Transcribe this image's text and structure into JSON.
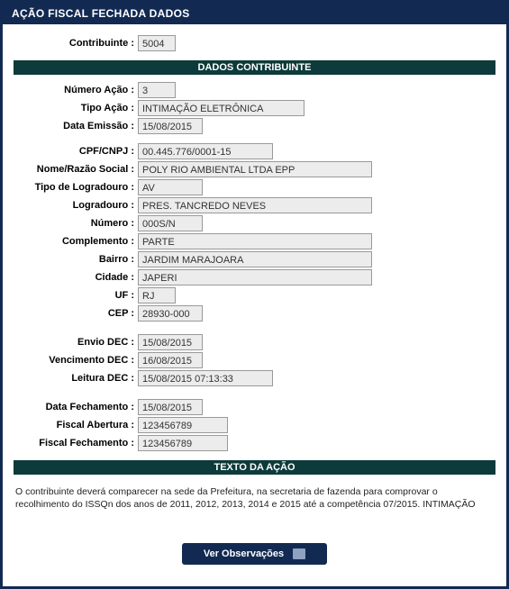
{
  "header": {
    "title": "AÇÃO FISCAL FECHADA DADOS"
  },
  "contribuinte": {
    "label": "Contribuinte :",
    "value": "5004"
  },
  "sections": {
    "dados_contribuinte": "DADOS CONTRIBUINTE",
    "texto_acao": "TEXTO DA AÇÃO"
  },
  "acao": {
    "numero_acao_label": "Número Ação :",
    "numero_acao": "3",
    "tipo_acao_label": "Tipo Ação :",
    "tipo_acao": "INTIMAÇÃO ELETRÔNICA",
    "data_emissao_label": "Data Emissão :",
    "data_emissao": "15/08/2015"
  },
  "endereco": {
    "cpf_cnpj_label": "CPF/CNPJ :",
    "cpf_cnpj": "00.445.776/0001-15",
    "nome_label": "Nome/Razão Social :",
    "nome": "POLY RIO AMBIENTAL LTDA EPP",
    "tipo_logradouro_label": "Tipo de Logradouro :",
    "tipo_logradouro": "AV",
    "logradouro_label": "Logradouro :",
    "logradouro": "PRES. TANCREDO NEVES",
    "numero_label": "Número :",
    "numero": "000S/N",
    "complemento_label": "Complemento :",
    "complemento": "PARTE",
    "bairro_label": "Bairro :",
    "bairro": "JARDIM MARAJOARA",
    "cidade_label": "Cidade :",
    "cidade": "JAPERI",
    "uf_label": "UF :",
    "uf": "RJ",
    "cep_label": "CEP :",
    "cep": "28930-000"
  },
  "dec": {
    "envio_label": "Envio DEC :",
    "envio": "15/08/2015",
    "venc_label": "Vencimento DEC :",
    "venc": "16/08/2015",
    "leitura_label": "Leitura DEC :",
    "leitura": "15/08/2015 07:13:33"
  },
  "fechamento": {
    "data_label": "Data Fechamento :",
    "data": "15/08/2015",
    "abertura_label": "Fiscal Abertura :",
    "abertura": "123456789",
    "fech_label": "Fiscal Fechamento :",
    "fech": "123456789"
  },
  "texto_acao_body": "O contribuinte deverá comparecer na sede da Prefeitura, na secretaria de fazenda para comprovar o recolhimento do ISSQn dos anos de 2011, 2012, 2013, 2014 e 2015 até a competência 07/2015. INTIMAÇÃO",
  "buttons": {
    "ver_obs": "Ver Observações"
  }
}
